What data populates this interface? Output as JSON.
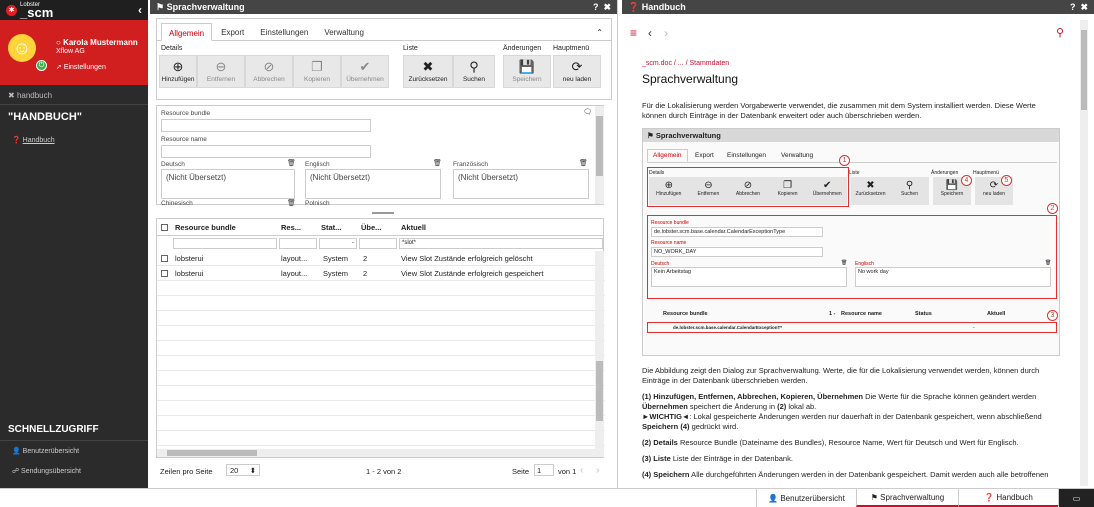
{
  "sidebar": {
    "logo_small": "Lobster",
    "logo_brand": "_scm",
    "user_name": "Karola Mustermann",
    "company": "Xflow AG",
    "settings": "Einstellungen",
    "search_label": "handbuch",
    "section_title": "\"HANDBUCH\"",
    "handbuch_link": "Handbuch",
    "quick_title": "SCHNELLZUGRIFF",
    "quick": [
      "Benutzerübersicht",
      "Sendungsübersicht"
    ]
  },
  "mid": {
    "title": "Sprachverwaltung",
    "tabs": [
      "Allgemein",
      "Export",
      "Einstellungen",
      "Verwaltung"
    ],
    "groups": {
      "details": "Details",
      "liste": "Liste",
      "aenderungen": "Änderungen",
      "hauptmenu": "Hauptmenü"
    },
    "buttons": [
      "Hinzufügen",
      "Entfernen",
      "Abbrechen",
      "Kopieren",
      "Übernehmen",
      "Zurücksetzen",
      "Suchen",
      "Speichern",
      "neu laden"
    ],
    "form": {
      "resource_bundle": "Resource bundle",
      "resource_name": "Resource name",
      "deutsch": "Deutsch",
      "englisch": "Englisch",
      "franzoesisch": "Französisch",
      "chinesisch": "Chinesisch",
      "polnisch": "Polnisch",
      "not_translated": "(Nicht Übersetzt)"
    },
    "grid": {
      "columns": [
        "Resource bundle",
        "Res...",
        "Stat...",
        "Übe...",
        "Aktuell"
      ],
      "filter_aktuell": "*slot*",
      "filter_status": "-",
      "rows": [
        [
          "lobsterui",
          "layout...",
          "System",
          "2",
          "View Slot Zustände erfolgreich gelöscht"
        ],
        [
          "lobsterui",
          "layout...",
          "System",
          "2",
          "View Slot Zustände erfolgreich gespeichert"
        ]
      ]
    },
    "pager": {
      "label": "Zeilen pro Seite",
      "per_page": "20",
      "range": "1 - 2 von 2",
      "page_label": "Seite",
      "page": "1",
      "of": "von 1"
    }
  },
  "right": {
    "title": "Handbuch",
    "breadcrumb": "_scm.doc / ... / Stammdaten",
    "heading": "Sprachverwaltung",
    "intro": "Für die Lokalisierung werden Vorgabewerte verwendet, die zusammen mit dem System installiert werden. Diese Werte können durch Einträge in der Datenbank erweitert oder auch überschrieben werden.",
    "fig": {
      "title": "Sprachverwaltung",
      "tabs": [
        "Allgemein",
        "Export",
        "Einstellungen",
        "Verwaltung"
      ],
      "groups": [
        "Details",
        "Liste",
        "Änderungen",
        "Hauptmenü"
      ],
      "buttons": [
        "Hinzufügen",
        "Entfernen",
        "Abbrechen",
        "Kopieren",
        "Übernehmen",
        "Zurücksetzen",
        "Suchen",
        "Speichern",
        "neu laden"
      ],
      "bundle_label": "Resource bundle",
      "bundle_value": "de.lobster.scm.base.calendar.CalendarExceptionType",
      "name_label": "Resource name",
      "name_value": "NO_WORK_DAY",
      "de_label": "Deutsch",
      "de_value": "Kein Arbeitstag",
      "en_label": "Englisch",
      "en_value": "No work day",
      "grid_cols": [
        "Resource bundle",
        "1 -",
        "Resource name",
        "Status",
        "Aktuell"
      ],
      "grid_filter": "de.lobster.scm.base.calendar.CalendarExceptionT*",
      "grid_status_filter": "-",
      "numbers": [
        "1",
        "2",
        "3",
        "4",
        "5"
      ]
    },
    "p1": "Die Abbildung zeigt den Dialog zur Sprachverwaltung. Werte, die für die Lokalisierung verwendet werden, können durch Einträge in der Datenbank überschrieben werden.",
    "p2a": "(1) Hinzufügen, Entfernen, Abbrechen, Kopieren, Übernehmen",
    "p2b": " Die Werte für die Sprache können geändert werden ",
    "p2c": "Übernehmen",
    "p2d": " speichert die Änderung in ",
    "p2e": "(2)",
    "p2f": " lokal ab.",
    "p2g": "►WICHTIG◄",
    "p2h": ": Lokal gespeicherte Änderungen werden nur dauerhaft in der Datenbank gespeichert, wenn abschließend ",
    "p2i": "Speichern (4)",
    "p2j": " gedrückt wird.",
    "p3a": "(2) Details",
    "p3b": " Resource Bundle (Dateiname des Bundles), Resource Name, Wert für Deutsch und Wert für Englisch.",
    "p4a": "(3) Liste",
    "p4b": " Liste der Einträge in der Datenbank.",
    "p5a": "(4) Speichern",
    "p5b": " Alle durchgeführten Änderungen werden in der Datenbank gespeichert. Damit werden auch alle betroffenen"
  },
  "bottom": {
    "tabs": [
      "Benutzerübersicht",
      "Sprachverwaltung",
      "Handbuch"
    ]
  },
  "colors": {
    "accent": "#c8102e",
    "sidebar": "#2b2b2b",
    "header": "#454545"
  }
}
